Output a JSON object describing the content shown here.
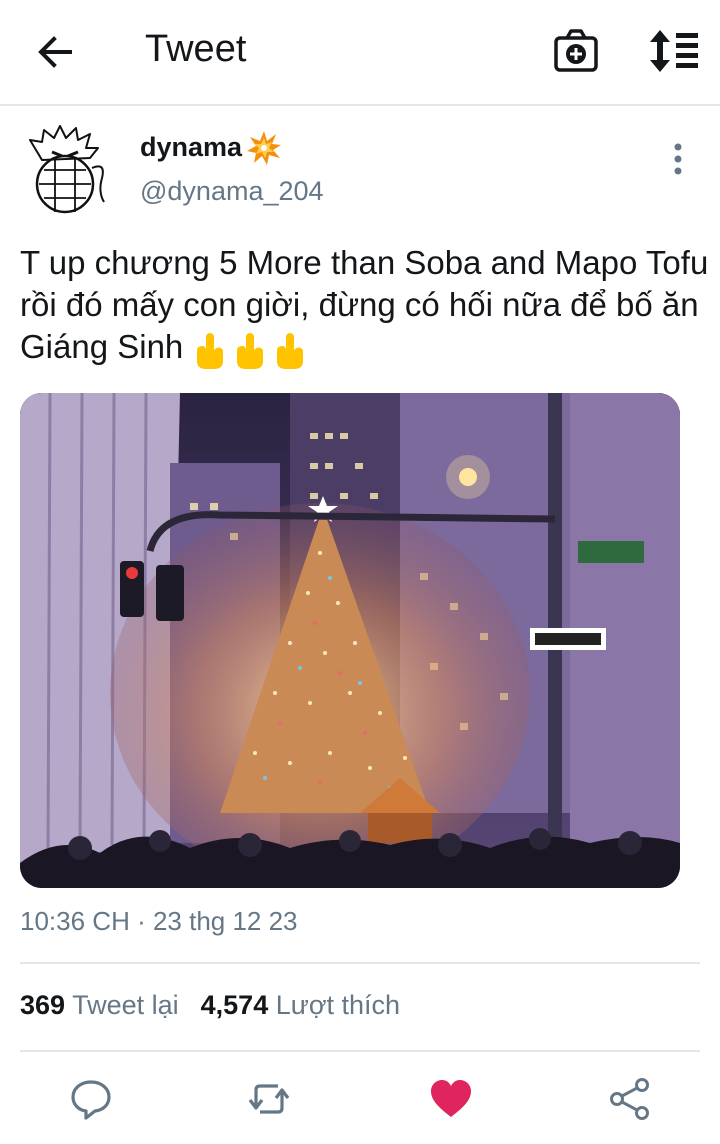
{
  "header": {
    "title": "Tweet",
    "back_icon": "arrow-left-icon",
    "camera_icon": "camera-plus-icon",
    "sort_icon": "sort-list-icon"
  },
  "author": {
    "display_name": "dynama",
    "name_emoji": "collision-icon",
    "handle": "@dynama_204"
  },
  "tweet": {
    "text": "T up chương 5 More than Soba and Mapo Tofu rồi đó mấy con giời, đừng có hối nữa để bố ăn Giáng Sinh",
    "trailing_emoji": [
      "middle-finger-icon",
      "middle-finger-icon",
      "middle-finger-icon"
    ],
    "timestamp": "10:36 CH · 23 thg 12 23"
  },
  "stats": {
    "retweet_count": "369",
    "retweet_label": "Tweet lại",
    "like_count": "4,574",
    "like_label": "Lượt thích"
  },
  "actions": {
    "reply_icon": "reply-icon",
    "retweet_icon": "retweet-icon",
    "like_icon": "heart-icon",
    "share_icon": "share-icon"
  },
  "colors": {
    "text": "#14171a",
    "secondary": "#657786",
    "divider": "#e1e8ed",
    "like": "#e0245e",
    "action": "#657786"
  }
}
